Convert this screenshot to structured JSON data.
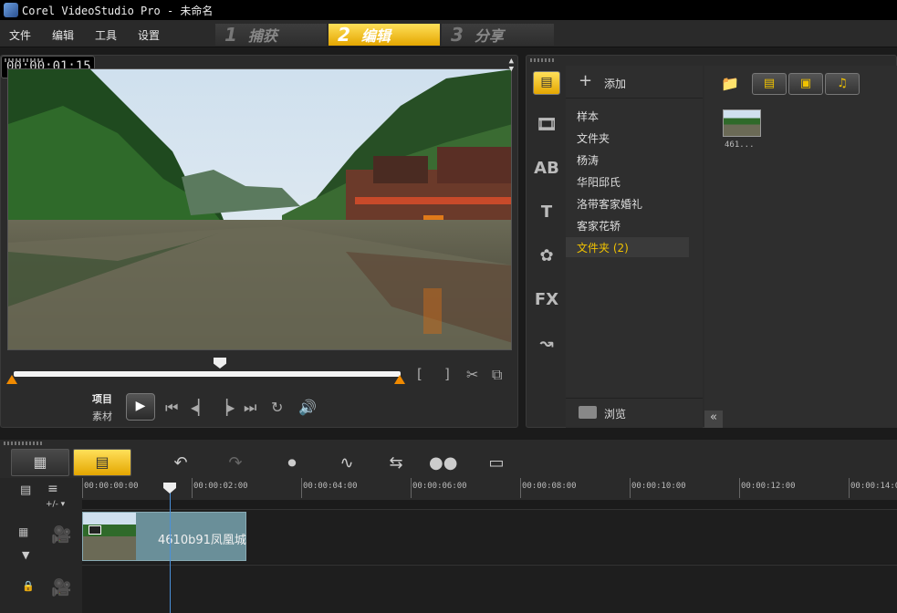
{
  "window": {
    "title": "Corel VideoStudio Pro - 未命名"
  },
  "menu": {
    "file": "文件",
    "edit": "编辑",
    "tools": "工具",
    "settings": "设置"
  },
  "steps": [
    {
      "num": "1",
      "label": "捕获"
    },
    {
      "num": "2",
      "label": "编辑"
    },
    {
      "num": "3",
      "label": "分享"
    }
  ],
  "player": {
    "project_label": "项目",
    "clip_label": "素材",
    "timecode": "00:00:01:15",
    "mark_in": "[",
    "mark_out": "]"
  },
  "library": {
    "add_label": "添加",
    "browse_label": "浏览",
    "folders": [
      "样本",
      "文件夹",
      "杨涛",
      "华阳邱氏",
      "洛带客家婚礼",
      "客家花轿",
      "文件夹 (2)"
    ],
    "selected_folder": "文件夹 (2)",
    "media": [
      {
        "caption": "461..."
      }
    ]
  },
  "timeline": {
    "ruler_ticks": [
      "00:00:00:00",
      "00:00:02:00",
      "00:00:04:00",
      "00:00:06:00",
      "00:00:08:00",
      "00:00:10:00",
      "00:00:12:00",
      "00:00:14:00"
    ],
    "clip_name": "4610b91凤凰城"
  },
  "colors": {
    "accent": "#f0c200",
    "tab_active": "#e4a600",
    "clip": "#6a8f99",
    "playhead": "#4a90d9"
  }
}
